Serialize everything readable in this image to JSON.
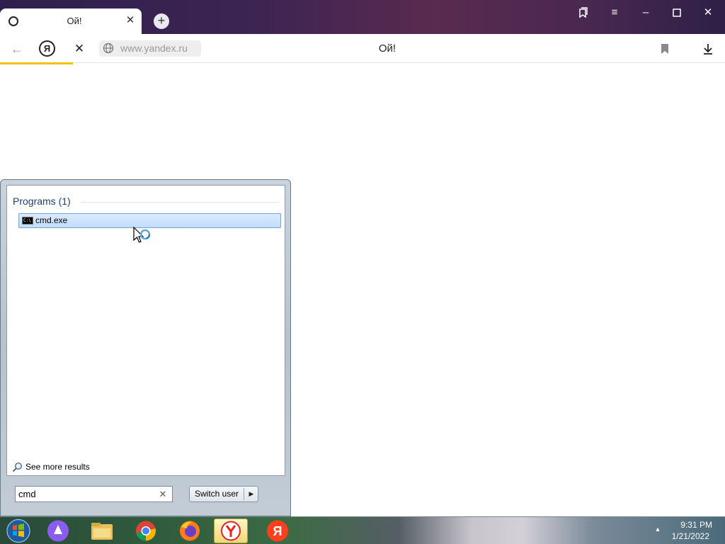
{
  "browser": {
    "tab_title": "Ой!",
    "tab_close": "✕",
    "new_tab": "+",
    "address_icon_letter": "Я",
    "url": "www.yandex.ru",
    "page_heading": "Ой!",
    "loading_progress": 0.1,
    "accent_color": "#f2c300",
    "window_controls": [
      "collections",
      "menu",
      "minimize",
      "maximize",
      "close"
    ]
  },
  "start_menu": {
    "programs_header": "Programs (1)",
    "results": [
      {
        "label": "cmd.exe",
        "icon": "cmd-icon",
        "icon_text": "C:\\"
      }
    ],
    "see_more_results": "See more results",
    "search_value": "cmd",
    "switch_user_label": "Switch user"
  },
  "taskbar": {
    "apps": [
      "start-orb-icon",
      "alice-icon",
      "explorer-icon",
      "chrome-icon",
      "firefox-icon",
      "yandex-browser-icon",
      "yandex-icon"
    ],
    "active_app": "yandex-browser-icon",
    "clock_time": "9:31 PM",
    "clock_date": "1/21/2022"
  }
}
